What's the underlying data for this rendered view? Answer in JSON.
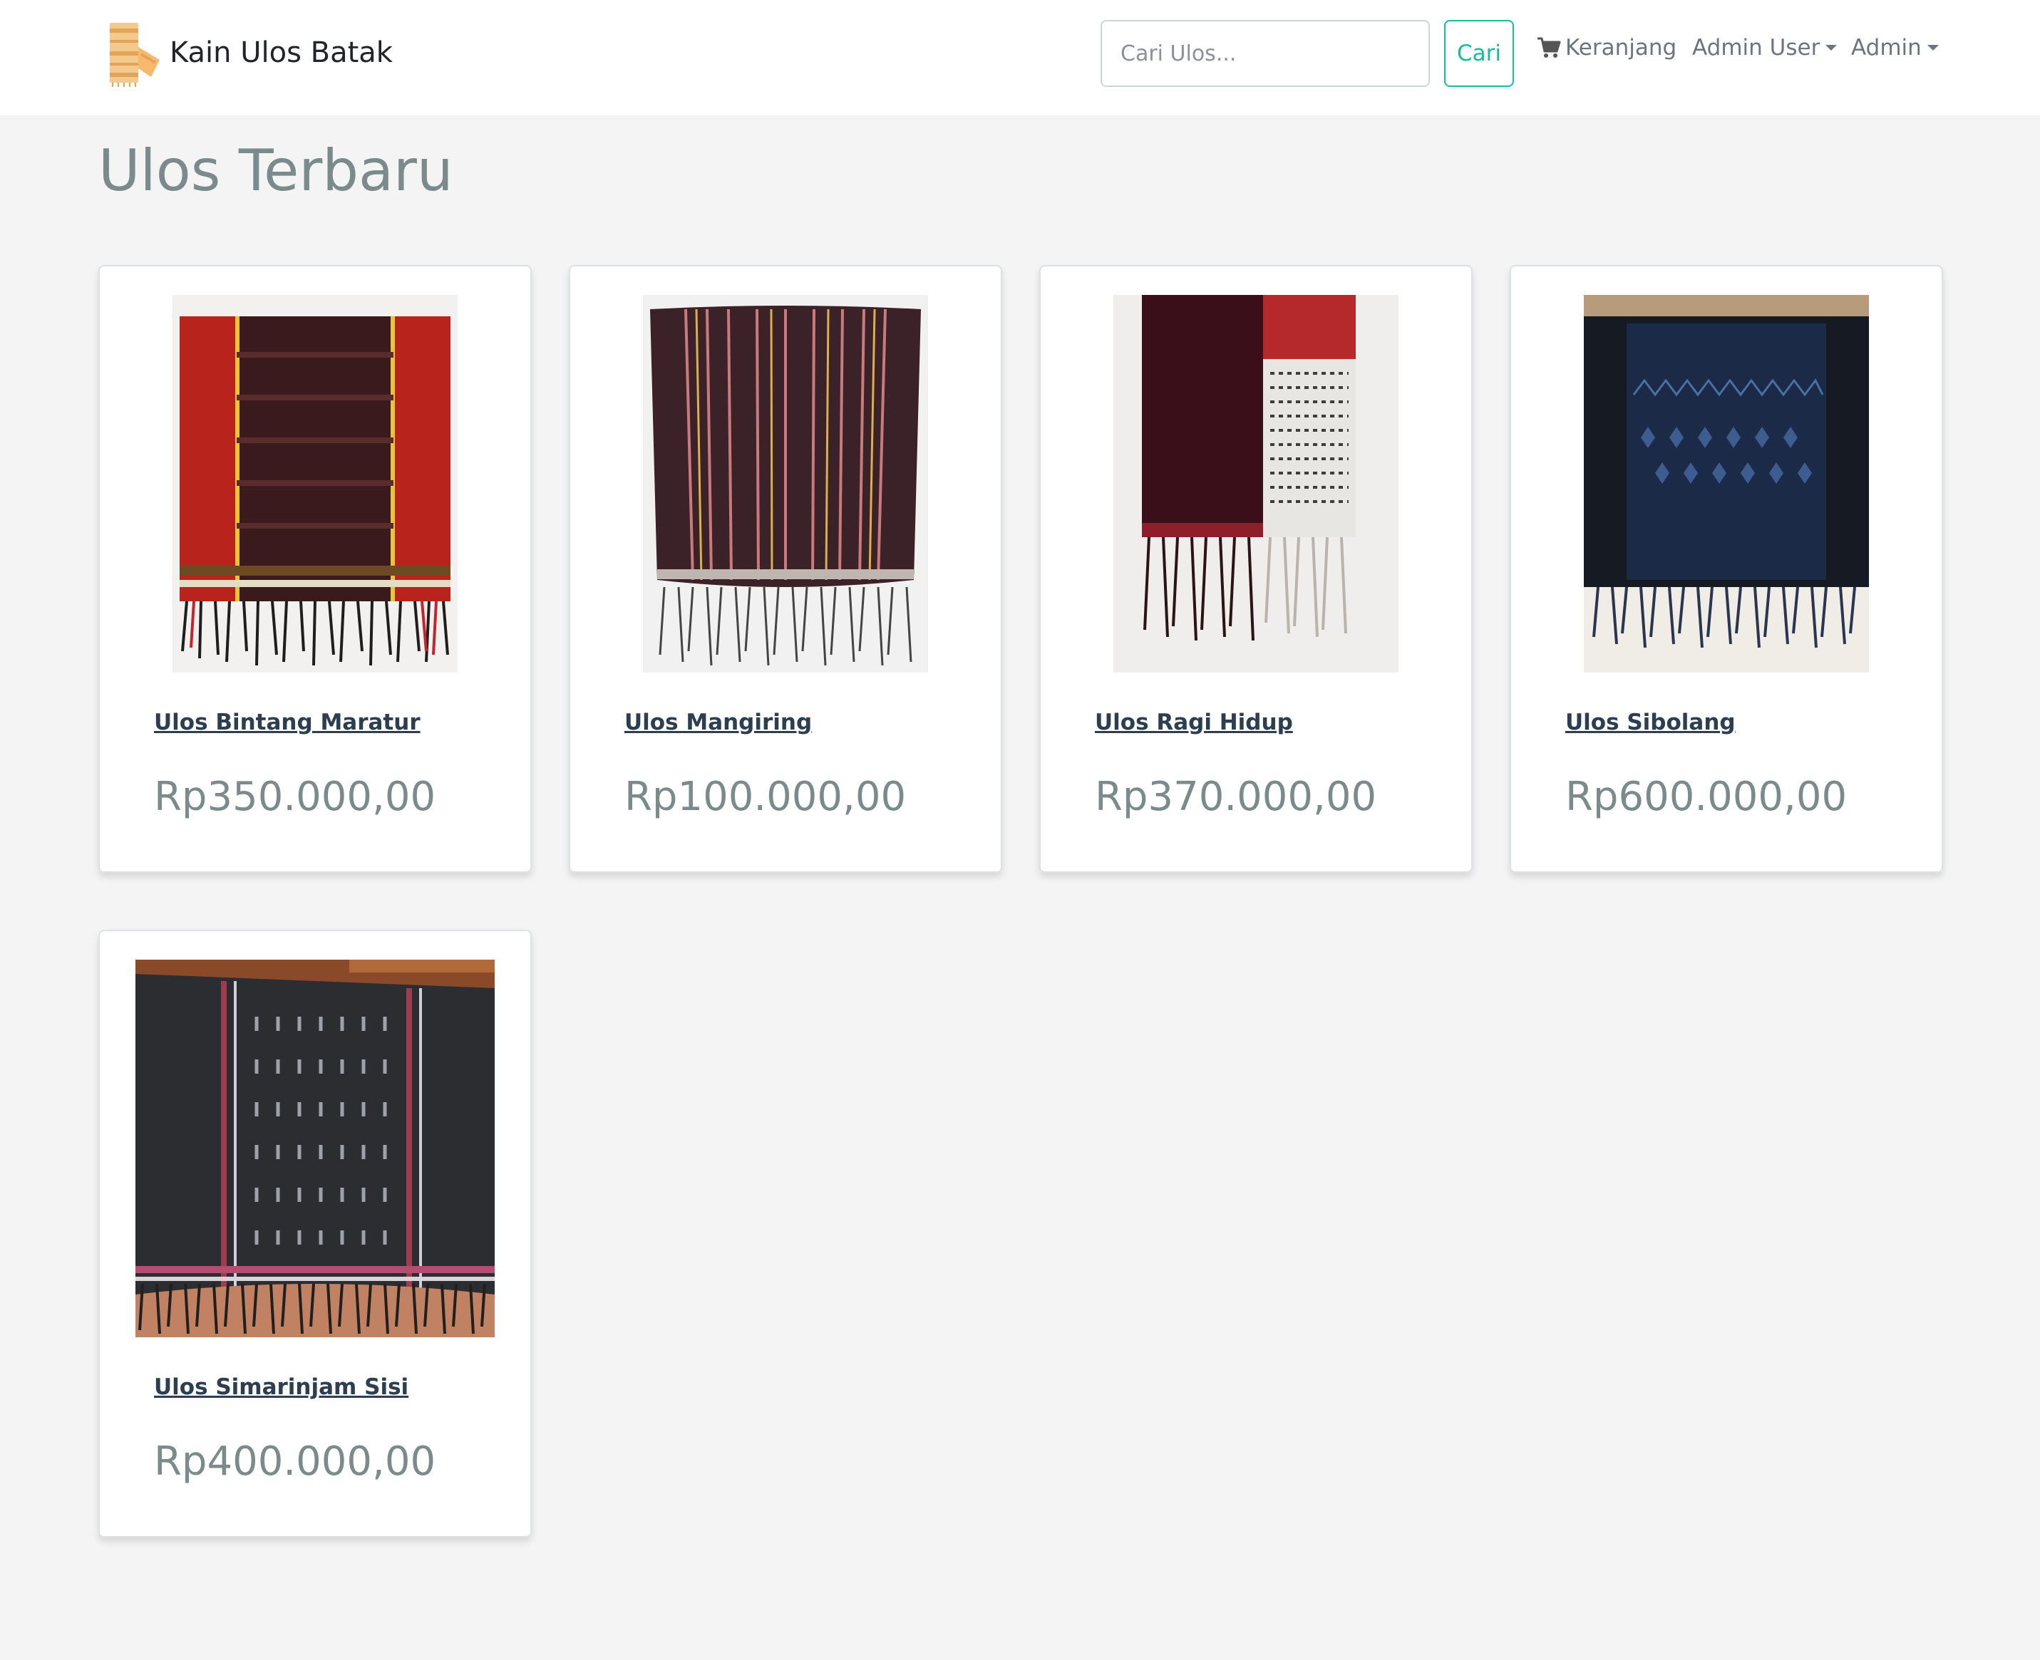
{
  "navbar": {
    "brand": "Kain Ulos Batak",
    "search": {
      "placeholder": "Cari Ulos...",
      "value": ""
    },
    "search_button": "Cari",
    "cart_label": "Keranjang",
    "admin_user_label": "Admin User",
    "admin_label": "Admin"
  },
  "main": {
    "title": "Ulos Terbaru",
    "products": [
      {
        "name": "Ulos Bintang Maratur",
        "price": "Rp350.000,00"
      },
      {
        "name": "Ulos Mangiring",
        "price": "Rp100.000,00"
      },
      {
        "name": "Ulos Ragi Hidup",
        "price": "Rp370.000,00"
      },
      {
        "name": "Ulos Sibolang",
        "price": "Rp600.000,00"
      },
      {
        "name": "Ulos Simarinjam Sisi",
        "price": "Rp400.000,00"
      }
    ]
  },
  "colors": {
    "accent": "#18bc9c",
    "link": "#2c3e50",
    "muted_heading": "#7b8a8b",
    "page_background": "#f4f4f4"
  },
  "icons": [
    "ulos-logo-icon",
    "shopping-cart-icon",
    "caret-down-icon"
  ]
}
